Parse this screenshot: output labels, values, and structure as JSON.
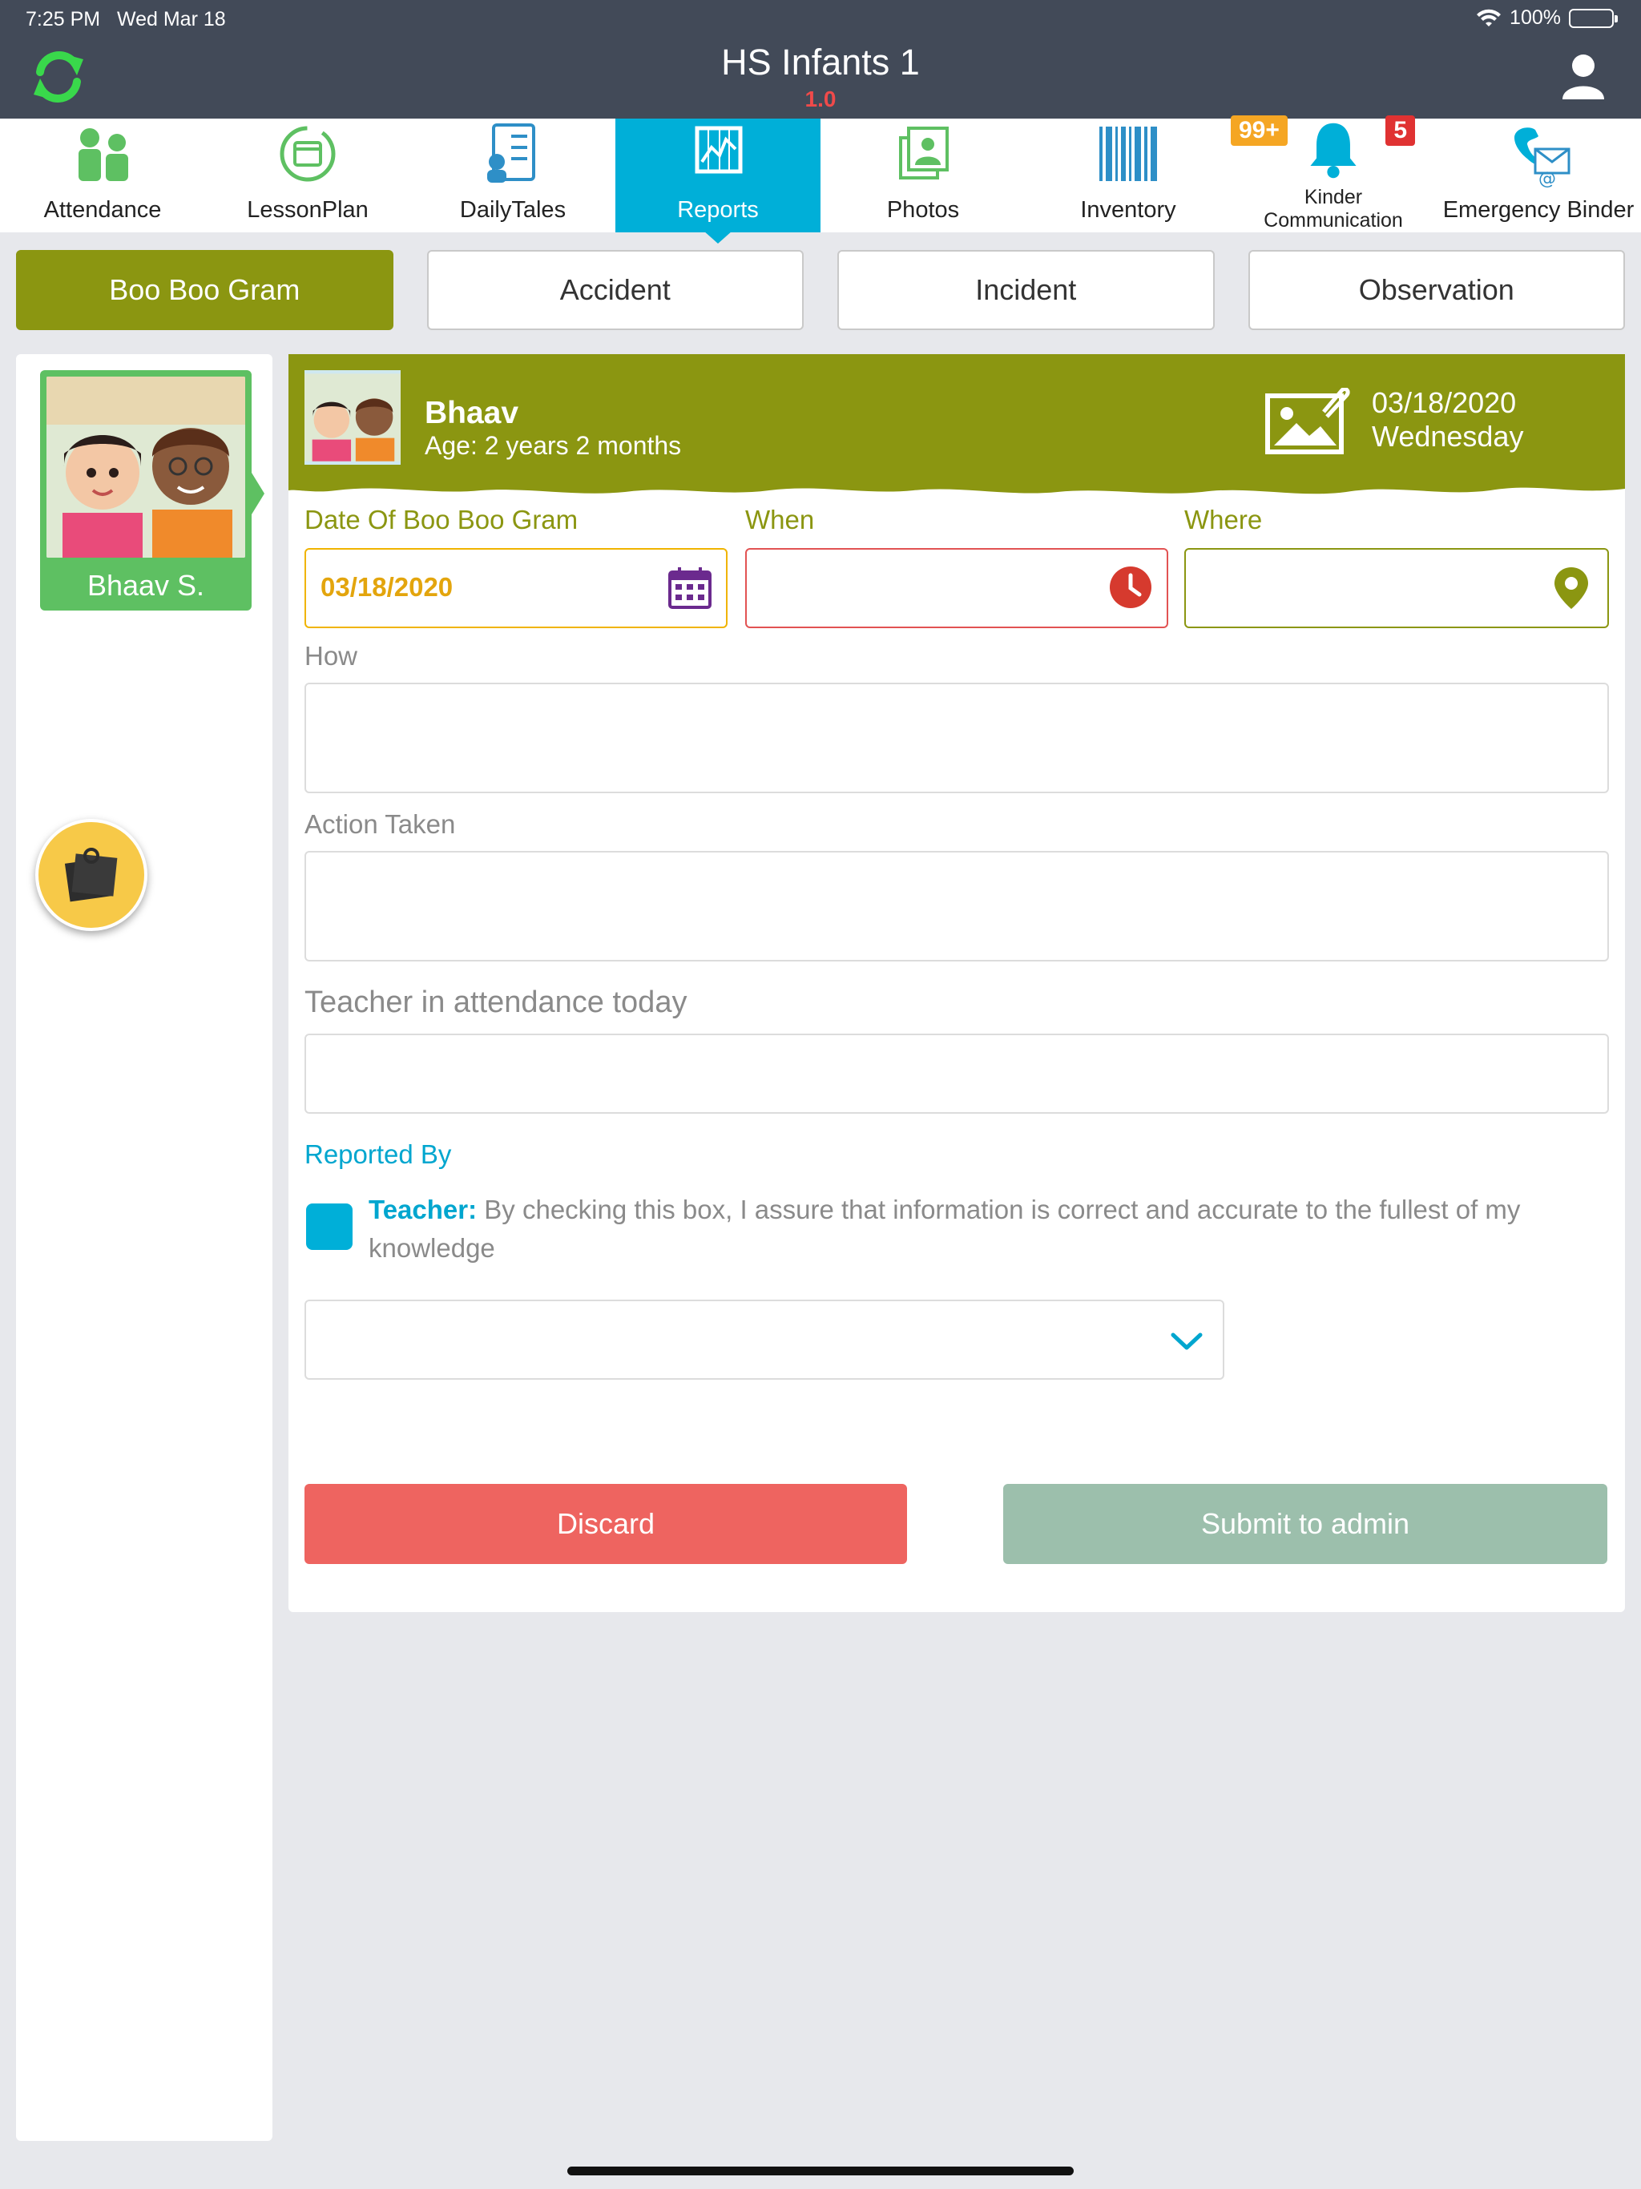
{
  "status_bar": {
    "time": "7:25 PM",
    "date": "Wed Mar 18",
    "battery": "100%"
  },
  "header": {
    "title": "HS Infants 1",
    "version": "1.0"
  },
  "nav": {
    "items": [
      {
        "label": "Attendance"
      },
      {
        "label": "LessonPlan"
      },
      {
        "label": "DailyTales"
      },
      {
        "label": "Reports"
      },
      {
        "label": "Photos"
      },
      {
        "label": "Inventory"
      },
      {
        "label_line1": "Kinder",
        "label_line2": "Communication",
        "badge_left": "99+",
        "badge_right": "5"
      },
      {
        "label": "Emergency Binder"
      }
    ],
    "active": "Reports"
  },
  "tabs": [
    {
      "label": "Boo Boo Gram",
      "active": true
    },
    {
      "label": "Accident",
      "active": false
    },
    {
      "label": "Incident",
      "active": false
    },
    {
      "label": "Observation",
      "active": false
    }
  ],
  "sidebar": {
    "child_name": "Bhaav S."
  },
  "report": {
    "child_name": "Bhaav",
    "age": "Age: 2 years 2 months",
    "date": "03/18/2020",
    "weekday": "Wednesday",
    "date_label": "Date Of Boo Boo Gram",
    "date_value": "03/18/2020",
    "when_label": "When",
    "where_label": "Where",
    "how_label": "How",
    "action_label": "Action Taken",
    "teacher_label": "Teacher in attendance today",
    "reported_by_label": "Reported By",
    "teacher_prefix": "Teacher:",
    "teacher_statement": " By checking this box, I assure that information is correct and accurate to the fullest of my knowledge",
    "discard": "Discard",
    "submit": "Submit to admin"
  },
  "colors": {
    "topbar": "#424a58",
    "accent": "#00afd8",
    "olive": "#8b9611",
    "discard": "#ee6460",
    "submit": "#9cbfac"
  }
}
